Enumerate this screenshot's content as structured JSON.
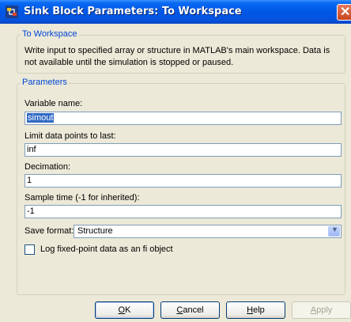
{
  "window": {
    "title": "Sink Block Parameters: To Workspace",
    "close_glyph": "✕"
  },
  "block_group": {
    "legend": "To Workspace",
    "description": "Write input to specified array or structure in MATLAB's main workspace. Data is not available until the simulation is stopped or paused."
  },
  "params": {
    "legend": "Parameters",
    "variable_name": {
      "label": "Variable name:",
      "value": "simout"
    },
    "limit": {
      "label": "Limit data points to last:",
      "value": "inf"
    },
    "decimation": {
      "label": "Decimation:",
      "value": "1"
    },
    "sample_time": {
      "label": "Sample time (-1 for inherited):",
      "value": "-1"
    },
    "save_format": {
      "label": "Save format:",
      "value": "Structure"
    },
    "log_fixed": {
      "label": "Log fixed-point data as an fi object",
      "checked": false
    }
  },
  "buttons": {
    "ok": {
      "key": "O",
      "rest": "K"
    },
    "cancel": {
      "key": "C",
      "rest": "ancel"
    },
    "help": {
      "key": "H",
      "rest": "elp"
    },
    "apply": {
      "key": "A",
      "rest": "pply"
    }
  },
  "icons": {
    "app": "simulink-icon",
    "dropdown": "chevron-down-icon"
  },
  "colors": {
    "titlebar": "#0058e6",
    "legend": "#0046d5",
    "selection": "#316ac5",
    "dialog_bg": "#ece9d8"
  }
}
